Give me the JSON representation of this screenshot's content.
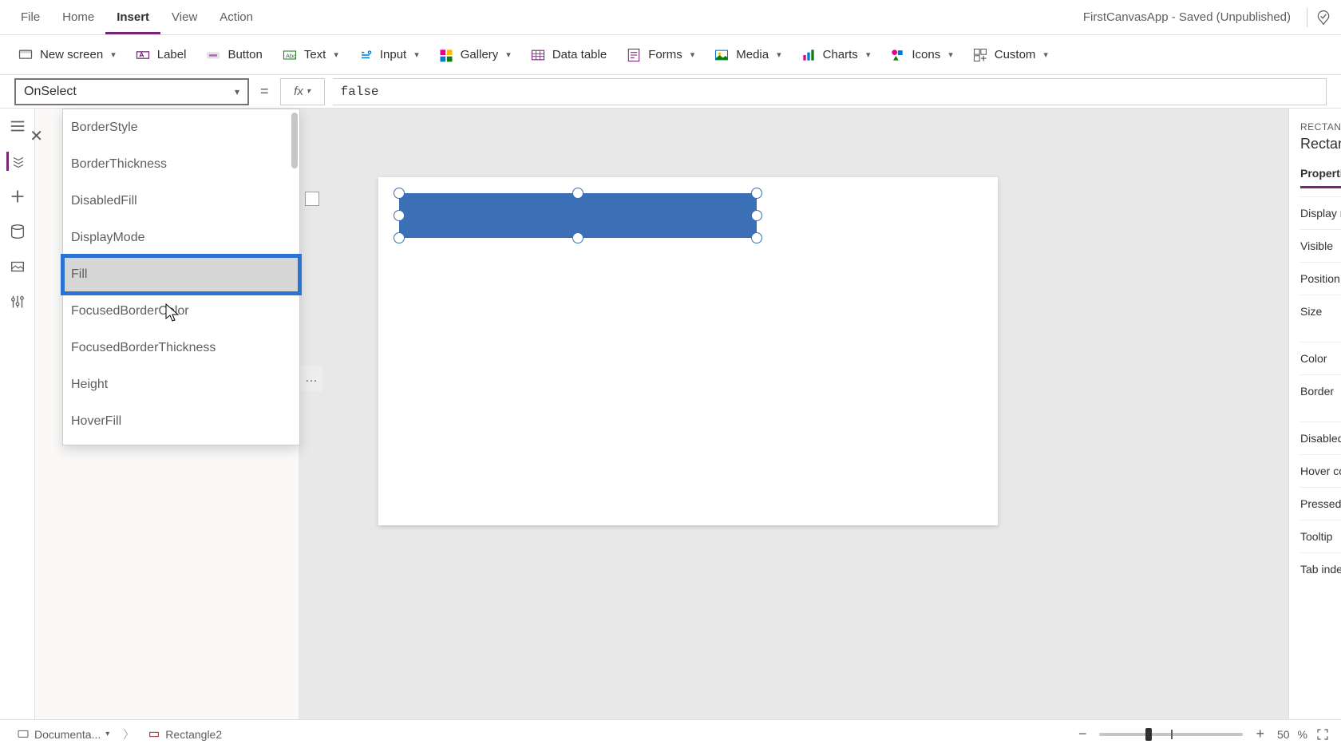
{
  "menubar": {
    "items": [
      "File",
      "Home",
      "Insert",
      "View",
      "Action"
    ],
    "active_index": 2,
    "app_title": "FirstCanvasApp - Saved (Unpublished)"
  },
  "ribbon": {
    "new_screen": "New screen",
    "label": "Label",
    "button": "Button",
    "text": "Text",
    "input": "Input",
    "gallery": "Gallery",
    "data_table": "Data table",
    "forms": "Forms",
    "media": "Media",
    "charts": "Charts",
    "icons": "Icons",
    "custom": "Custom"
  },
  "formula": {
    "property": "OnSelect",
    "value": "false"
  },
  "property_dropdown": {
    "items": [
      "BorderStyle",
      "BorderThickness",
      "DisabledFill",
      "DisplayMode",
      "Fill",
      "FocusedBorderColor",
      "FocusedBorderThickness",
      "Height",
      "HoverFill"
    ],
    "highlighted_index": 4
  },
  "right_panel": {
    "type_label": "RECTANGLE",
    "name": "Rectangle",
    "tabs": [
      "Properties"
    ],
    "rows": [
      "Display mo",
      "Visible",
      "Position",
      "Size",
      "Color",
      "Border",
      "Disabled co",
      "Hover colo",
      "Pressed col",
      "Tooltip",
      "Tab index"
    ]
  },
  "statusbar": {
    "screen": "Documenta...",
    "element": "Rectangle2",
    "zoom_percent": "50",
    "zoom_unit": "%"
  }
}
